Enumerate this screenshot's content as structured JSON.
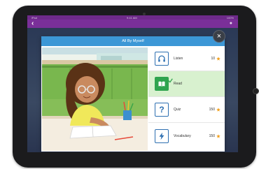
{
  "status_bar": {
    "left": "iPad",
    "center": "9:41 AM",
    "right": "100%"
  },
  "modal": {
    "title": "All By Myself"
  },
  "menu": {
    "items": [
      {
        "key": "listen",
        "label": "Listen",
        "points": "10",
        "icon": "headphones-icon",
        "selected": false
      },
      {
        "key": "read",
        "label": "Read",
        "points": "",
        "icon": "book-icon",
        "selected": true
      },
      {
        "key": "quiz",
        "label": "Quiz",
        "points": "150",
        "icon": "question-icon",
        "selected": false
      },
      {
        "key": "vocabulary",
        "label": "Vocabulary",
        "points": "150",
        "icon": "lightning-icon",
        "selected": false
      }
    ]
  },
  "colors": {
    "app_bar": "#7a2f99",
    "title_bar": "#3c97d6",
    "selected_row": "#d8f1cf",
    "icon_accent": "#2d6fb1",
    "star": "#f2a01c"
  }
}
